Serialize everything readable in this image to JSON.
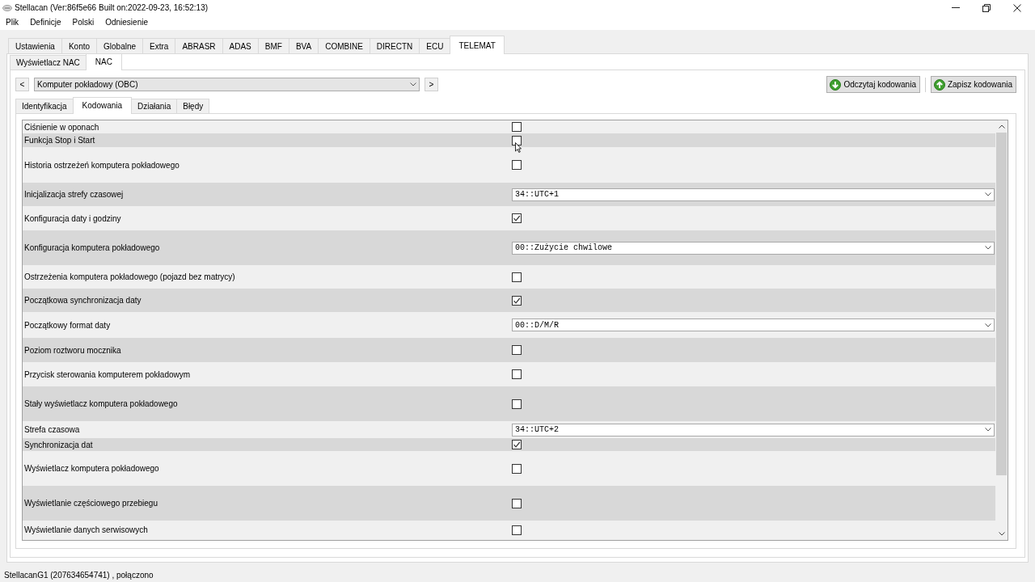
{
  "window": {
    "title": "Stellacan (Ver:86f5e66 Built on:2022-09-23, 16:52:13)"
  },
  "menu": [
    "Plik",
    "Definicje",
    "Polski",
    "Odniesienie"
  ],
  "tabs": [
    {
      "label": "Ustawienia",
      "selected": false
    },
    {
      "label": "Konto",
      "selected": false
    },
    {
      "label": "Globalne",
      "selected": false
    },
    {
      "label": "Extra",
      "selected": false
    },
    {
      "label": "ABRASR",
      "selected": false
    },
    {
      "label": "ADAS",
      "selected": false
    },
    {
      "label": "BMF",
      "selected": false
    },
    {
      "label": "BVA",
      "selected": false
    },
    {
      "label": "COMBINE",
      "selected": false
    },
    {
      "label": "DIRECTN",
      "selected": false
    },
    {
      "label": "ECU",
      "selected": false
    },
    {
      "label": "TELEMAT",
      "selected": true
    }
  ],
  "subtabs": [
    {
      "label": "Wyświetlacz NAC",
      "selected": false
    },
    {
      "label": "NAC",
      "selected": true
    }
  ],
  "module_selector": {
    "prev": "<",
    "value": "Komputer pokładowy (OBC)",
    "next": ">"
  },
  "actions": [
    {
      "label": "Odczytaj kodowania",
      "kind": "read"
    },
    {
      "label": "Zapisz kodowania",
      "kind": "write"
    }
  ],
  "section_tabs": [
    {
      "label": "Identyfikacja",
      "selected": false
    },
    {
      "label": "Kodowania",
      "selected": true
    },
    {
      "label": "Działania",
      "selected": false
    },
    {
      "label": "Błędy",
      "selected": false
    }
  ],
  "codings": [
    {
      "label": "Ciśnienie w oponach",
      "kind": "checkbox",
      "checked": false
    },
    {
      "label": "Funkcja Stop i Start",
      "kind": "checkbox",
      "checked": false
    },
    {
      "label": "Historia ostrzeżeń komputera pokładowego",
      "kind": "checkbox",
      "checked": false
    },
    {
      "label": "Inicjalizacja strefy czasowej",
      "kind": "select",
      "value": "34::UTC+1"
    },
    {
      "label": "Konfiguracja daty i godziny",
      "kind": "checkbox",
      "checked": true
    },
    {
      "label": "Konfiguracja komputera pokładowego",
      "kind": "select",
      "value": "00::Zużycie chwilowe"
    },
    {
      "label": "Ostrzeżenia komputera pokładowego (pojazd bez matrycy)",
      "kind": "checkbox",
      "checked": false
    },
    {
      "label": "Początkowa synchronizacja daty",
      "kind": "checkbox",
      "checked": true
    },
    {
      "label": "Początkowy format daty",
      "kind": "select",
      "value": "00::D/M/R"
    },
    {
      "label": "Poziom roztworu mocznika",
      "kind": "checkbox",
      "checked": false
    },
    {
      "label": "Przycisk sterowania komputerem pokładowym",
      "kind": "checkbox",
      "checked": false
    },
    {
      "label": "Stały wyświetlacz komputera pokładowego",
      "kind": "checkbox",
      "checked": false
    },
    {
      "label": "Strefa czasowa",
      "kind": "select",
      "value": "34::UTC+2"
    },
    {
      "label": "Synchronizacja dat",
      "kind": "checkbox",
      "checked": true
    },
    {
      "label": "Wyświetlacz komputera pokładowego",
      "kind": "checkbox",
      "checked": false
    },
    {
      "label": "Wyświetlanie częściowego przebiegu",
      "kind": "checkbox",
      "checked": false
    },
    {
      "label": "Wyświetlanie danych serwisowych",
      "kind": "checkbox",
      "checked": false
    }
  ],
  "status_bar": "StellacanG1 (207634654741) , połączono"
}
